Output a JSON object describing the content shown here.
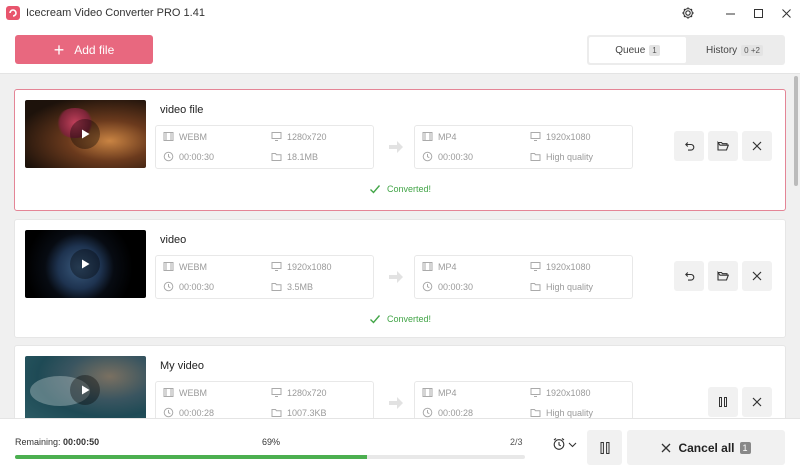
{
  "app": {
    "title": "Icecream Video Converter PRO 1.41"
  },
  "header": {
    "add_file_label": "Add file",
    "tabs": [
      {
        "label": "Queue",
        "count": "1"
      },
      {
        "label": "History",
        "count": "0 +2"
      }
    ]
  },
  "queue": [
    {
      "name": "video file",
      "source": {
        "format": "WEBM",
        "resolution": "1280x720",
        "duration": "00:00:30",
        "size": "18.1MB"
      },
      "output": {
        "format": "MP4",
        "resolution": "1920x1080",
        "duration": "00:00:30",
        "quality": "High quality"
      },
      "status": "Converted!"
    },
    {
      "name": "video",
      "source": {
        "format": "WEBM",
        "resolution": "1920x1080",
        "duration": "00:00:30",
        "size": "3.5MB"
      },
      "output": {
        "format": "MP4",
        "resolution": "1920x1080",
        "duration": "00:00:30",
        "quality": "High quality"
      },
      "status": "Converted!"
    },
    {
      "name": "My video",
      "source": {
        "format": "WEBM",
        "resolution": "1280x720",
        "duration": "00:00:28",
        "size": "1007.3KB"
      },
      "output": {
        "format": "MP4",
        "resolution": "1920x1080",
        "duration": "00:00:28",
        "quality": "High quality"
      },
      "status": ""
    }
  ],
  "footer": {
    "remaining_label": "Remaining:",
    "remaining_value": "00:00:50",
    "percent_label": "69%",
    "progress": 0.69,
    "counter": "2/3",
    "cancel_all_label": "Cancel all",
    "cancel_all_count": "1"
  },
  "colors": {
    "accent": "#e8687f",
    "success": "#42a547",
    "progress": "#4caf50"
  }
}
